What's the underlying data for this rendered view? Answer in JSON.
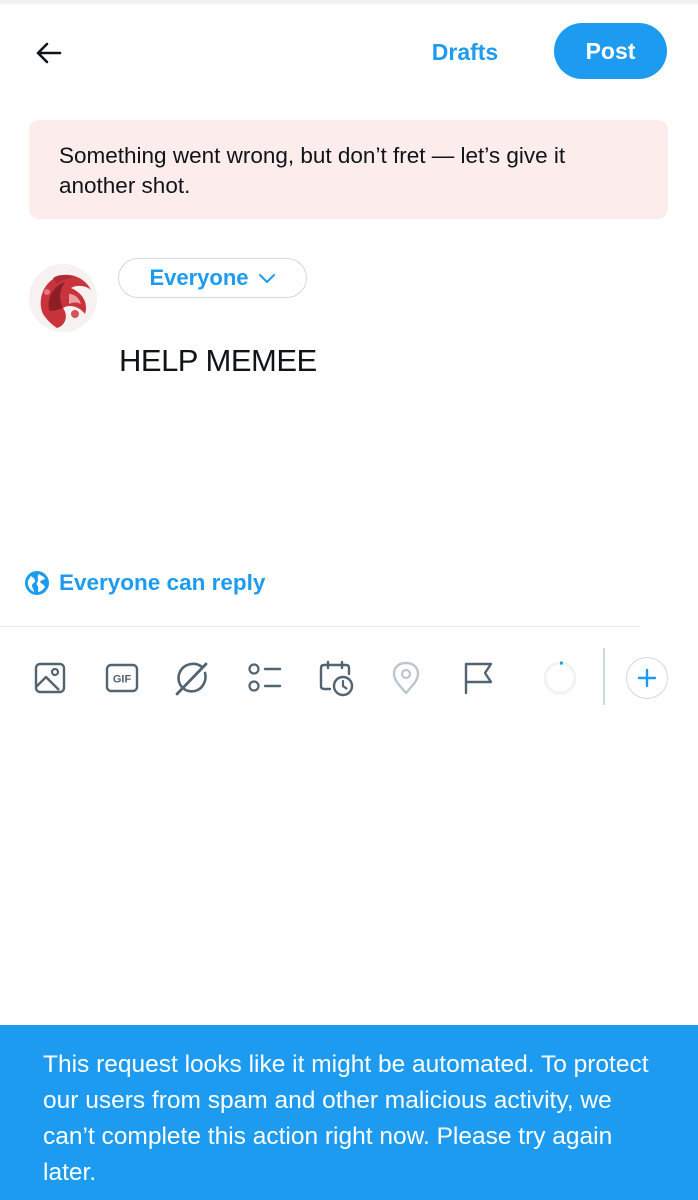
{
  "header": {
    "back_icon": "arrow-left-icon",
    "drafts_label": "Drafts",
    "post_label": "Post"
  },
  "error_banner": {
    "message": "Something went wrong, but don’t fret — let’s give it another shot."
  },
  "composer": {
    "avatar_icon": "avatar",
    "audience_label": "Everyone",
    "audience_icon": "chevron-down-icon",
    "text": "HELP MEMEE",
    "reply_setting_icon": "globe-icon",
    "reply_setting_label": "Everyone can reply"
  },
  "toolbar": {
    "icons": [
      "image-icon",
      "gif-icon",
      "grok-icon",
      "poll-icon",
      "schedule-icon",
      "location-icon",
      "flag-icon",
      "character-count-icon",
      "add-icon"
    ],
    "gif_text": "GIF",
    "char_progress": 0.03
  },
  "toast": {
    "message": "This request looks like it might be automated. To protect our users from spam and other malicious activity, we can’t complete this action right now. Please try again later."
  },
  "colors": {
    "accent": "#1d9bf0",
    "error_bg": "#fdecec",
    "icon_gray": "#536471"
  }
}
